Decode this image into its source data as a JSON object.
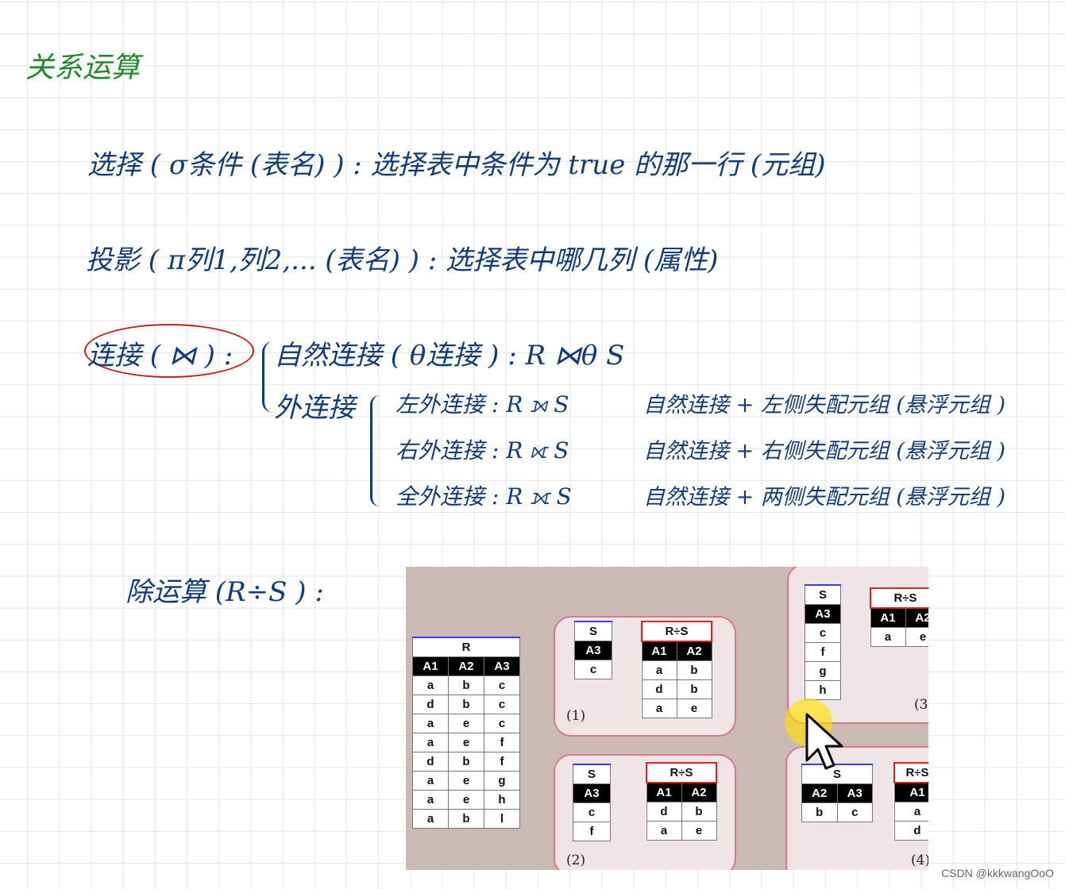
{
  "title": "关系运算",
  "selection_line": "选择 ( σ条件 (表名) ) : 选择表中条件为 true 的那一行 (元组)",
  "projection_line": "投影 ( π列1,列2,... (表名) ) : 选择表中哪几列 (属性)",
  "join_label": "连接 ( ⋈ ) :",
  "natural_join": "自然连接 ( θ连接 ) : R ⋈θ S",
  "outer_join": "外连接",
  "left_outer": "左外连接 : R ⟕ S",
  "right_outer": "右外连接 : R ⟖ S",
  "full_outer": "全外连接 : R ⟗ S",
  "left_desc": "自然连接 + 左侧失配元组 (悬浮元组 )",
  "right_desc": "自然连接 + 右侧失配元组 (悬浮元组 )",
  "full_desc": "自然连接 + 两侧失配元组 (悬浮元组 )",
  "division_line": "除运算 (R÷S ) :",
  "figure": {
    "table_r": {
      "caption": "R",
      "header": [
        "A1",
        "A2",
        "A3"
      ],
      "rows": [
        [
          "a",
          "b",
          "c"
        ],
        [
          "d",
          "b",
          "c"
        ],
        [
          "a",
          "e",
          "c"
        ],
        [
          "a",
          "e",
          "f"
        ],
        [
          "d",
          "b",
          "f"
        ],
        [
          "a",
          "e",
          "g"
        ],
        [
          "a",
          "e",
          "h"
        ],
        [
          "a",
          "b",
          "l"
        ]
      ]
    },
    "case1": {
      "label": "(1)",
      "s_caption": "S",
      "s_header": [
        "A3"
      ],
      "s_rows": [
        [
          "c"
        ]
      ],
      "res_caption": "R÷S",
      "res_header": [
        "A1",
        "A2"
      ],
      "res_rows": [
        [
          "a",
          "b"
        ],
        [
          "d",
          "b"
        ],
        [
          "a",
          "e"
        ]
      ]
    },
    "case2": {
      "label": "(2)",
      "s_caption": "S",
      "s_header": [
        "A3"
      ],
      "s_rows": [
        [
          "c"
        ],
        [
          "f"
        ]
      ],
      "res_caption": "R÷S",
      "res_header": [
        "A1",
        "A2"
      ],
      "res_rows": [
        [
          "d",
          "b"
        ],
        [
          "a",
          "e"
        ]
      ]
    },
    "case3": {
      "label": "(3",
      "s_caption": "S",
      "s_header": [
        "A3"
      ],
      "s_rows": [
        [
          "c"
        ],
        [
          "f"
        ],
        [
          "g"
        ],
        [
          "h"
        ]
      ],
      "res_caption": "R÷S",
      "res_header": [
        "A1",
        "A2"
      ],
      "res_rows": [
        [
          "a",
          "e"
        ]
      ]
    },
    "case4": {
      "label": "(4)",
      "s_caption": "S",
      "s_header": [
        "A2",
        "A3"
      ],
      "s_rows": [
        [
          "b",
          "c"
        ]
      ],
      "res_caption": "R÷S",
      "res_header": [
        "A1"
      ],
      "res_rows": [
        [
          "a"
        ],
        [
          "d"
        ]
      ]
    }
  },
  "credit": "CSDN @kkkwangOoO"
}
